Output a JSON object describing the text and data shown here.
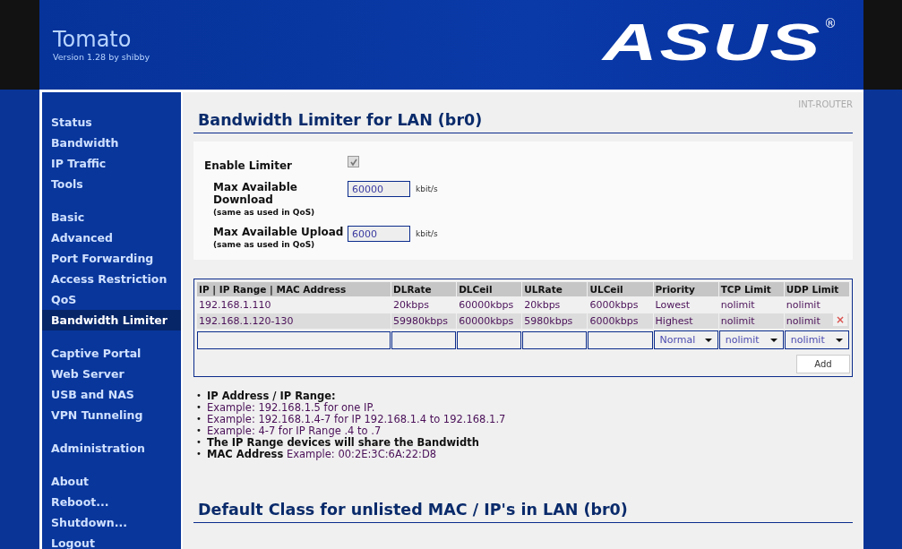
{
  "header": {
    "title": "Tomato",
    "version": "Version 1.28 by shibby",
    "logo": "ASUS",
    "logo_mark": "®"
  },
  "sidebar": {
    "groups": [
      {
        "items": [
          {
            "label": "Status",
            "selected": false
          },
          {
            "label": "Bandwidth",
            "selected": false
          },
          {
            "label": "IP Traffic",
            "selected": false
          },
          {
            "label": "Tools",
            "selected": false
          }
        ]
      },
      {
        "items": [
          {
            "label": "Basic",
            "selected": false
          },
          {
            "label": "Advanced",
            "selected": false
          },
          {
            "label": "Port Forwarding",
            "selected": false
          },
          {
            "label": "Access Restriction",
            "selected": false
          },
          {
            "label": "QoS",
            "selected": false
          },
          {
            "label": "Bandwidth Limiter",
            "selected": true
          }
        ]
      },
      {
        "items": [
          {
            "label": "Captive Portal",
            "selected": false
          },
          {
            "label": "Web Server",
            "selected": false
          },
          {
            "label": "USB and NAS",
            "selected": false
          },
          {
            "label": "VPN Tunneling",
            "selected": false
          }
        ]
      },
      {
        "items": [
          {
            "label": "Administration",
            "selected": false
          }
        ]
      },
      {
        "items": [
          {
            "label": "About",
            "selected": false
          },
          {
            "label": "Reboot...",
            "selected": false
          },
          {
            "label": "Shutdown...",
            "selected": false
          },
          {
            "label": "Logout",
            "selected": false
          }
        ]
      }
    ]
  },
  "router_name": "INT-ROUTER",
  "section_title": "Bandwidth Limiter for LAN (br0)",
  "settings": {
    "enable": {
      "label": "Enable Limiter",
      "checked": true
    },
    "fields": [
      {
        "label": "Max Available Download",
        "note": "(same as used in QoS)",
        "value": "60000",
        "unit": "kbit/s"
      },
      {
        "label": "Max Available Upload",
        "note": "(same as used in QoS)",
        "value": "6000",
        "unit": "kbit/s"
      }
    ]
  },
  "table": {
    "columns": [
      "IP | IP Range | MAC Address",
      "DLRate",
      "DLCeil",
      "ULRate",
      "ULCeil",
      "Priority",
      "TCP Limit",
      "UDP Limit"
    ],
    "rows": [
      {
        "cells": [
          "192.168.1.110",
          "20kbps",
          "60000kbps",
          "20kbps",
          "6000kbps",
          "Lowest",
          "nolimit",
          "nolimit"
        ]
      },
      {
        "cells": [
          "192.168.1.120-130",
          "59980kbps",
          "60000kbps",
          "5980kbps",
          "6000kbps",
          "Highest",
          "nolimit",
          "nolimit"
        ],
        "delete": "×"
      }
    ],
    "new_row": {
      "selects": [
        "Normal",
        "nolimit",
        "nolimit"
      ],
      "add_button": "Add"
    }
  },
  "notes": [
    {
      "bullet": "•",
      "text": "IP Address / IP Range:",
      "bold": true
    },
    {
      "bullet": "•",
      "text": "Example: 192.168.1.5 for one IP.",
      "bold": false
    },
    {
      "bullet": "•",
      "text": "Example: 192.168.1.4-7 for IP 192.168.1.4 to 192.168.1.7",
      "bold": false
    },
    {
      "bullet": "•",
      "text": "Example: 4-7 for IP Range .4 to .7",
      "bold": false
    },
    {
      "bullet": "•",
      "text": "The IP Range devices will share the Bandwidth",
      "bold": true
    },
    {
      "bullet": "•",
      "text": "**MAC Address** Example: 00:2E:3C:6A:22:D8",
      "bold": false
    }
  ],
  "next_section_title": "Default Class for unlisted MAC / IP's in LAN (br0)"
}
